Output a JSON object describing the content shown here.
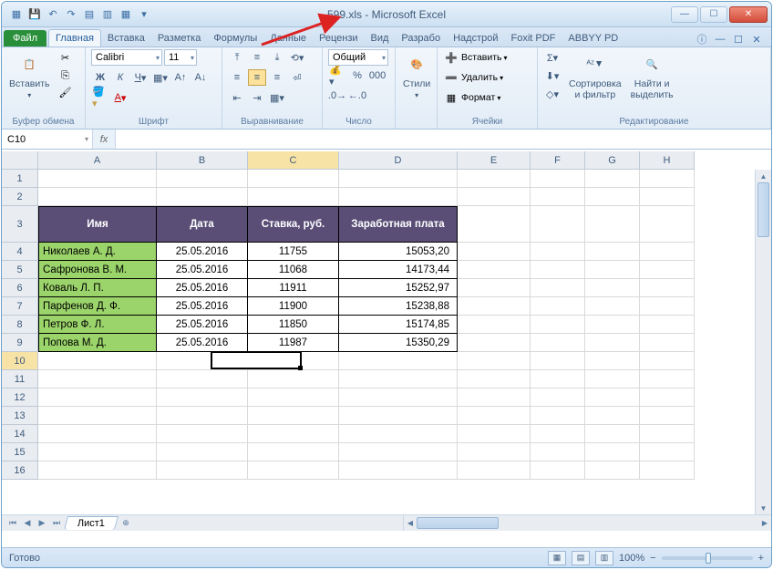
{
  "window": {
    "title": "599.xls  -  Microsoft Excel"
  },
  "tabs": {
    "file": "Файл",
    "items": [
      "Главная",
      "Вставка",
      "Разметка",
      "Формулы",
      "Данные",
      "Рецензи",
      "Вид",
      "Разрабо",
      "Надстрой",
      "Foxit PDF",
      "ABBYY PD"
    ],
    "active": 0
  },
  "ribbon": {
    "clipboard": {
      "label": "Буфер обмена",
      "paste": "Вставить"
    },
    "font": {
      "label": "Шрифт",
      "name": "Calibri",
      "size": "11"
    },
    "align": {
      "label": "Выравнивание"
    },
    "number": {
      "label": "Число",
      "format": "Общий"
    },
    "styles": {
      "label": "",
      "styles_btn": "Стили"
    },
    "cells": {
      "label": "Ячейки",
      "insert": "Вставить",
      "delete": "Удалить",
      "format": "Формат"
    },
    "editing": {
      "label": "Редактирование",
      "sort": "Сортировка\nи фильтр",
      "find": "Найти и\nвыделить"
    }
  },
  "formula_bar": {
    "name": "C10",
    "fx": "fx",
    "value": ""
  },
  "columns": [
    {
      "id": "A",
      "w": 130
    },
    {
      "id": "B",
      "w": 100
    },
    {
      "id": "C",
      "w": 100
    },
    {
      "id": "D",
      "w": 130
    },
    {
      "id": "E",
      "w": 80
    },
    {
      "id": "F",
      "w": 60
    },
    {
      "id": "G",
      "w": 60
    },
    {
      "id": "H",
      "w": 60
    }
  ],
  "rows": [
    "1",
    "2",
    "3",
    "4",
    "5",
    "6",
    "7",
    "8",
    "9",
    "10",
    "11",
    "12",
    "13",
    "14",
    "15",
    "16"
  ],
  "headers": [
    "Имя",
    "Дата",
    "Ставка, руб.",
    "Заработная плата"
  ],
  "data": [
    {
      "name": "Николаев А. Д.",
      "date": "25.05.2016",
      "rate": "11755",
      "salary": "15053,20"
    },
    {
      "name": "Сафронова В. М.",
      "date": "25.05.2016",
      "rate": "11068",
      "salary": "14173,44"
    },
    {
      "name": "Коваль Л. П.",
      "date": "25.05.2016",
      "rate": "11911",
      "salary": "15252,97"
    },
    {
      "name": "Парфенов Д. Ф.",
      "date": "25.05.2016",
      "rate": "11900",
      "salary": "15238,88"
    },
    {
      "name": "Петров Ф. Л.",
      "date": "25.05.2016",
      "rate": "11850",
      "salary": "15174,85"
    },
    {
      "name": "Попова М. Д.",
      "date": "25.05.2016",
      "rate": "11987",
      "salary": "15350,29"
    }
  ],
  "sheet": {
    "name": "Лист1"
  },
  "status": {
    "ready": "Готово",
    "zoom": "100%"
  }
}
